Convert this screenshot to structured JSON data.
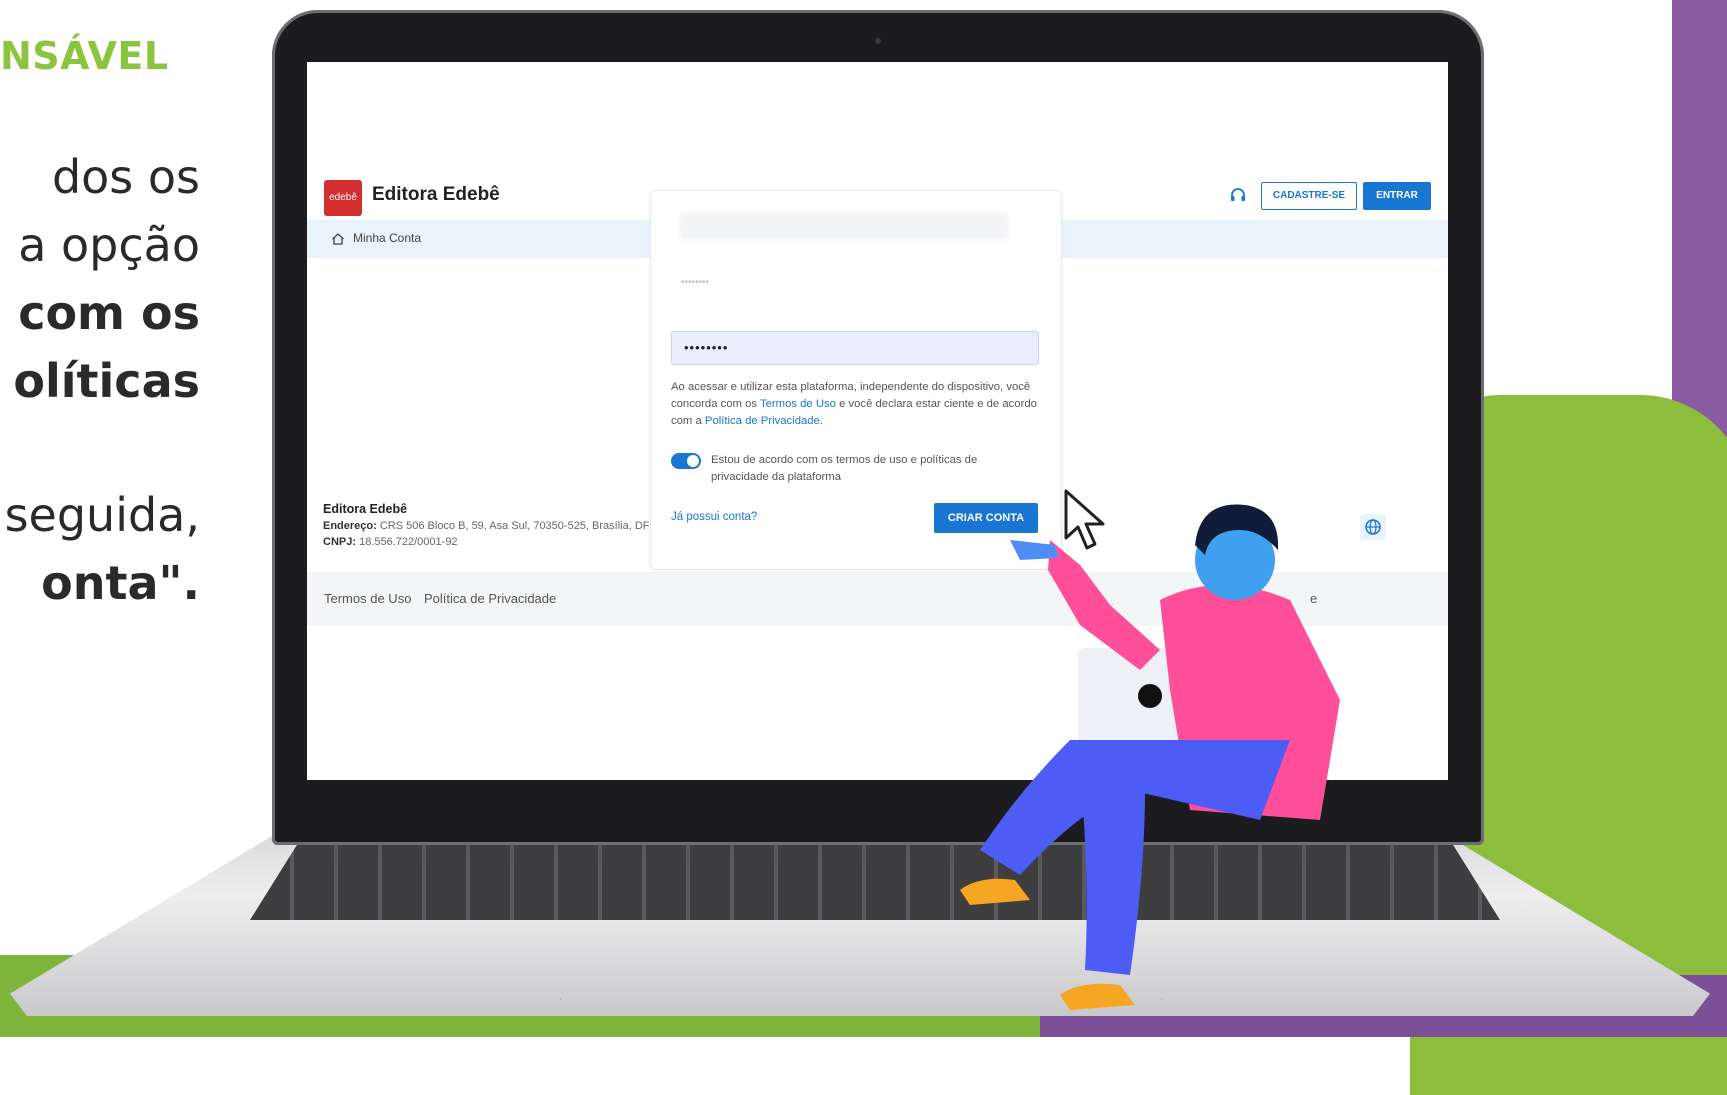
{
  "instructions": {
    "heading_fragment": "NSÁVEL",
    "lines": [
      {
        "text": "dos os",
        "bold": false
      },
      {
        "text": "a opção",
        "bold": false
      },
      {
        "text": "com os",
        "bold": true
      },
      {
        "text": "olíticas",
        "bold": true
      },
      {
        "text": "seguida,",
        "bold": false
      },
      {
        "text": "onta\".",
        "bold": true
      }
    ]
  },
  "app": {
    "logo_text": "edebê",
    "brand": "Editora Edebê",
    "header": {
      "support_icon": "headset-icon",
      "signup_label": "CADASTRE-SE",
      "login_label": "ENTRAR"
    },
    "subnav": {
      "home_icon": "home-icon",
      "label": "Minha Conta"
    },
    "form": {
      "password_ghost": "••••••••",
      "password_value": "••••••••",
      "terms_before": "Ao acessar e utilizar esta plataforma, independente do dispositivo, você concorda com os ",
      "terms_link": "Termos de Uso",
      "terms_middle": " e você declara estar ciente e de acordo com a ",
      "privacy_link": "Política de Privacidade",
      "terms_end": ".",
      "agree_toggle_on": true,
      "agree_text": "Estou de acordo com os termos de uso e políticas de privacidade da plataforma",
      "have_account_link": "Já possui conta?",
      "create_button": "CRIAR CONTA"
    },
    "footer": {
      "company_name": "Editora Edebê",
      "address_label": "Endereço:",
      "address_value": " CRS 506 Bloco B, 59, Asa Sul, 70350-525, Brasília, DF",
      "cnpj_label": "CNPJ:",
      "cnpj_value": " 18.556.722/0001-92",
      "globe_icon": "globe-icon",
      "links": [
        "Termos de Uso",
        "Política de Privacidade"
      ],
      "edge_fragment": "e"
    }
  },
  "colors": {
    "accent_blue": "#1976d2",
    "brand_red": "#d32f2f",
    "green": "#8cc43f",
    "purple": "#8a5aa3"
  }
}
